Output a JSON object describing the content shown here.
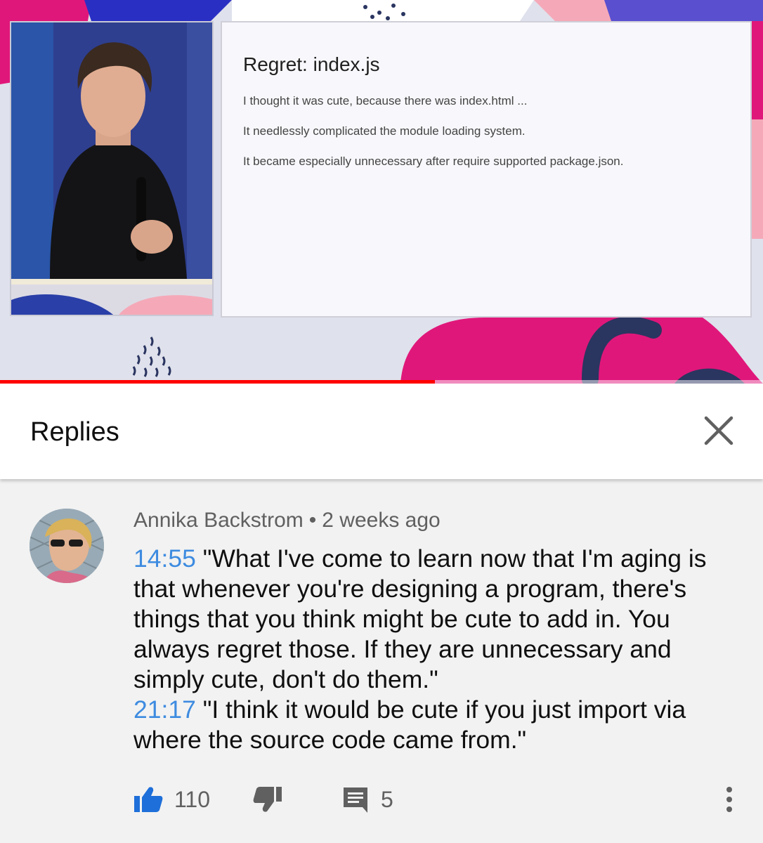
{
  "slide": {
    "title": "Regret: index.js",
    "lines": [
      "I thought it was cute, because there was index.html ...",
      "It needlessly complicated the module loading system.",
      "It became especially unnecessary after require supported package.json."
    ]
  },
  "player": {
    "progress_fraction": 0.57,
    "progress_color": "#ff0000"
  },
  "replies": {
    "title": "Replies"
  },
  "comment": {
    "author": "Annika Backstrom",
    "separator": "•",
    "time_ago": "2 weeks ago",
    "segments": [
      {
        "timestamp": "14:55",
        "text": "\"What I've come to learn now that I'm aging is that whenever you're designing a program, there's things that you think might be cute to add in. You always regret those. If they are unnecessary and simply cute, don't do them.\""
      },
      {
        "timestamp": "21:17",
        "text": "\"I think it would be cute if you just import via where the source code came from.\""
      }
    ],
    "likes": "110",
    "replies_count": "5"
  },
  "colors": {
    "timestamp": "#3d8be0",
    "like_active": "#1e6fd9",
    "icon_grey": "#606060"
  },
  "icons": {
    "close": "close-icon",
    "like": "thumbs-up-icon",
    "dislike": "thumbs-down-icon",
    "reply": "comment-icon",
    "more": "more-vertical-icon"
  }
}
